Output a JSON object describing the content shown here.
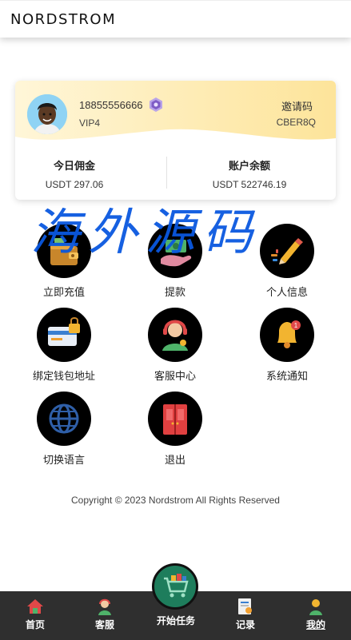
{
  "header": {
    "logo": "NORDSTROM"
  },
  "account": {
    "phone": "18855556666",
    "vip_level": "VIP4",
    "invite_label": "邀请码",
    "invite_code": "CBER8Q"
  },
  "stats": {
    "commission_label": "今日佣金",
    "commission_value": "USDT 297.06",
    "balance_label": "账户余额",
    "balance_value": "USDT 522746.19"
  },
  "watermark": {
    "text": "海外源码"
  },
  "menu": [
    {
      "label": "立即充值",
      "icon": "wallet-icon"
    },
    {
      "label": "提款",
      "icon": "cash-hand-icon"
    },
    {
      "label": "个人信息",
      "icon": "pencil-icon"
    },
    {
      "label": "绑定钱包地址",
      "icon": "card-lock-icon"
    },
    {
      "label": "客服中心",
      "icon": "support-agent-icon"
    },
    {
      "label": "系统通知",
      "icon": "bell-icon"
    },
    {
      "label": "切换语言",
      "icon": "globe-icon"
    },
    {
      "label": "退出",
      "icon": "door-icon"
    }
  ],
  "footer": {
    "copyright": "Copyright © 2023 Nordstrom All Rights Reserved"
  },
  "tabbar": {
    "home": "首页",
    "service": "客服",
    "start_task": "开始任务",
    "records": "记录",
    "mine": "我的"
  },
  "colors": {
    "card_gradient": "#fde9a6",
    "tabbar_bg": "#2f2f2f",
    "center_button": "#1e7d5c",
    "watermark": "#0a58e0"
  }
}
